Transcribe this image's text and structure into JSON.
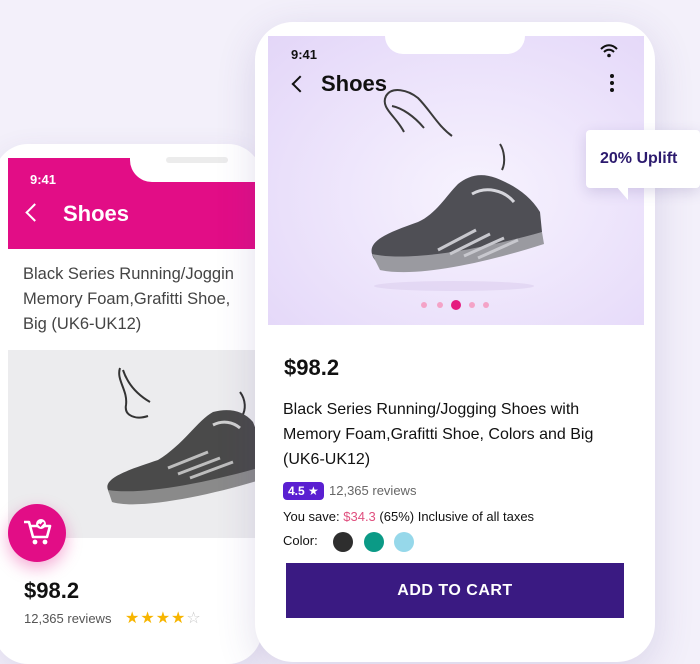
{
  "back_screen": {
    "time": "9:41",
    "title": "Shoes",
    "description_lines": [
      "Black Series Running/Joggin",
      "Memory Foam,Grafitti Shoe,",
      "Big (UK6-UK12)"
    ],
    "price": "$98.2",
    "reviews": "12,365 reviews",
    "stars_filled": 4,
    "stars_total": 5,
    "cart_icon": "cart-icon"
  },
  "front_screen": {
    "time": "9:41",
    "title": "Shoes",
    "carousel": {
      "count": 5,
      "active_index": 2
    },
    "price": "$98.2",
    "product_name": "Black Series Running/Jogging Shoes with Memory Foam,Grafitti Shoe, Colors and Big (UK6-UK12)",
    "rating": "4.5 ★",
    "reviews": "12,365 reviews",
    "save_label": "You save:",
    "save_amount": "$34.3",
    "save_rest": "(65%) Inclusive of all taxes",
    "color_label": "Color:",
    "colors": [
      "#2e2e2e",
      "#0b9a86",
      "#96d8ea"
    ],
    "add_to_cart": "ADD TO CART"
  },
  "callout": {
    "text": "20% Uplift"
  },
  "brand_colors": {
    "magenta": "#e20d86",
    "purple": "#3a1a82",
    "rating": "#5a1fd1"
  }
}
